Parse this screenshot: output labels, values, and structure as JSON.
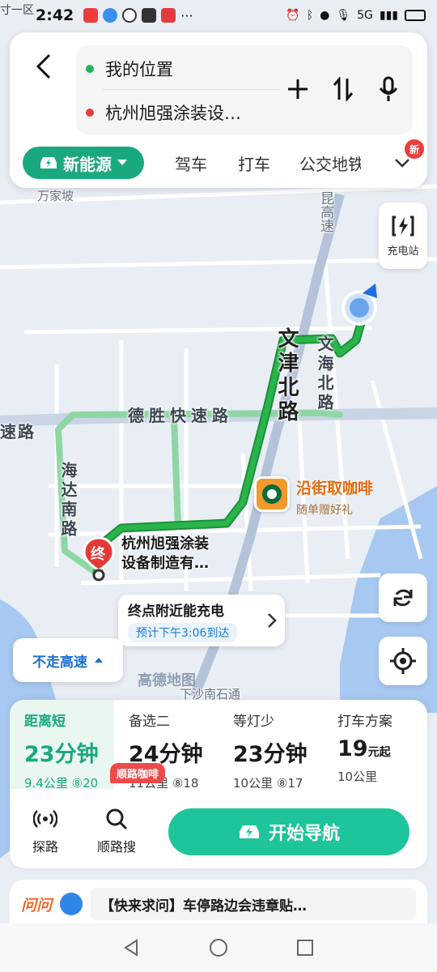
{
  "status_bar": {
    "area_tag": "寸一区",
    "time": "2:42",
    "network": "5G"
  },
  "route_card": {
    "origin": "我的位置",
    "destination": "杭州旭强涂装设…",
    "tabs": [
      {
        "label": "新能源",
        "active": true
      },
      {
        "label": "驾车"
      },
      {
        "label": "打车"
      },
      {
        "label": "公交地铁"
      }
    ],
    "new_badge": "新"
  },
  "map": {
    "labels": {
      "wanjiapo": "万家坡",
      "kungao": "昆高速",
      "wenjin": "文津北路",
      "wenhai": "文海北路",
      "desheng": "德胜快速路",
      "su_road": "速路",
      "haida": "海达南路",
      "xiashanan": "下沙南石通"
    },
    "charge_station_label": "充电站",
    "coffee_poi": {
      "name": "沿街取咖啡",
      "sub": "随单赠好礼"
    },
    "destination_pin": "终",
    "destination_label_line1": "杭州旭强涂装",
    "destination_label_line2": "设备制造有…",
    "charge_tip": {
      "title": "终点附近能充电",
      "eta": "预计下午3:06到达"
    },
    "avoid_highway": "不走高速",
    "watermark": "高德地图",
    "colors": {
      "route_main": "#28b54a",
      "route_alt": "#8fd6a5",
      "water": "#a7c8f0"
    }
  },
  "routes": [
    {
      "label": "距离短",
      "duration": "23分钟",
      "distance": "9.4公里",
      "lights": "20",
      "active": true
    },
    {
      "label": "备选二",
      "duration": "24分钟",
      "distance": "11公里",
      "lights": "18"
    },
    {
      "label": "等灯少",
      "duration": "23分钟",
      "distance": "10公里",
      "lights": "17"
    },
    {
      "label": "打车方案",
      "duration": "19",
      "duration_unit": "元起",
      "distance": "10公里"
    }
  ],
  "actions": {
    "explore": "探路",
    "along_search": "顺路搜",
    "along_badge": "顺路咖啡",
    "start_nav": "开始导航"
  },
  "ask_bar": {
    "logo": "问问",
    "text": "【快来求问】车停路边会违章贴…"
  }
}
